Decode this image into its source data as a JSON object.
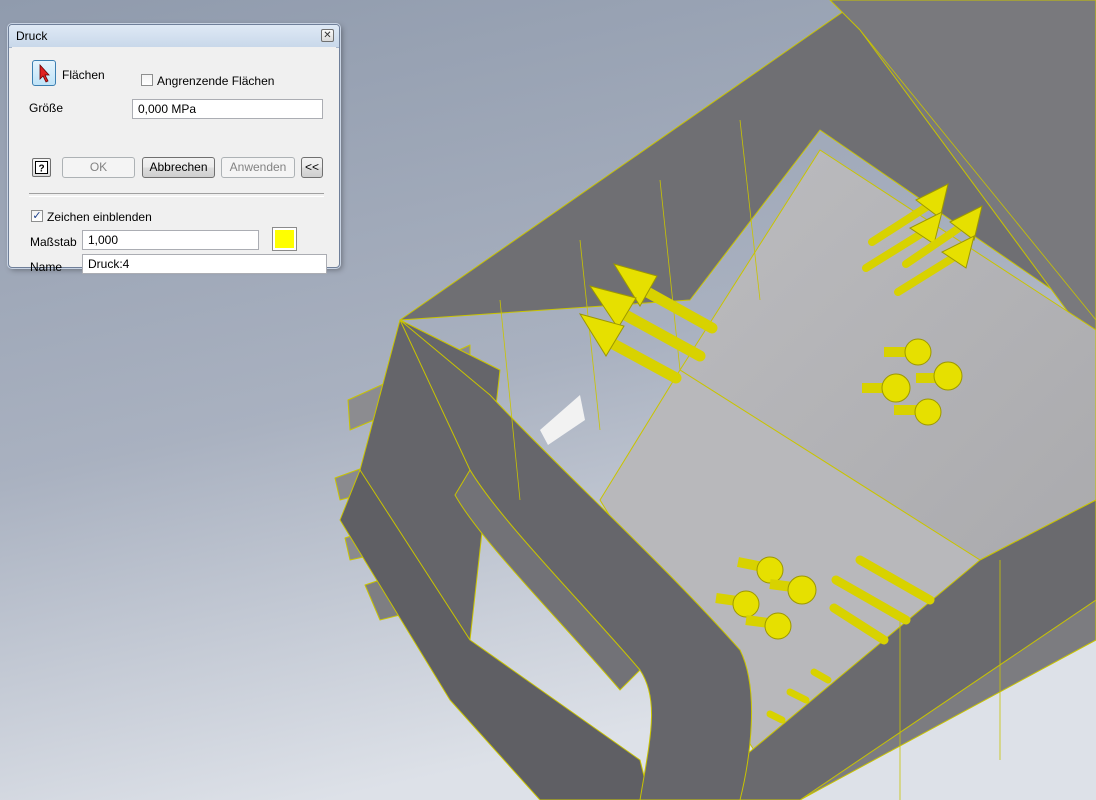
{
  "dialog": {
    "title": "Druck",
    "faces_label": "Flächen",
    "adjacent_faces_label": "Angrenzende Flächen",
    "adjacent_faces_checked": false,
    "magnitude_label": "Größe",
    "magnitude_value": "0,000 MPa",
    "ok_label": "OK",
    "cancel_label": "Abbrechen",
    "apply_label": "Anwenden",
    "collapse_label": "<<",
    "show_glyph_label": "Zeichen einblenden",
    "show_glyph_checked": true,
    "scale_label": "Maßstab",
    "scale_value": "1,000",
    "glyph_color": "#ffff00",
    "name_label": "Name",
    "name_value": "Druck:4"
  },
  "colors": {
    "background_top": "#98a2b3",
    "background_bottom": "#d8dde6",
    "model_gray": "#6e6e72",
    "model_floor": "#b4b4b8",
    "load_yellow": "#e8e000"
  },
  "icons": {
    "select": "cursor-arrow-icon",
    "help": "help-icon",
    "close": "close-icon"
  }
}
